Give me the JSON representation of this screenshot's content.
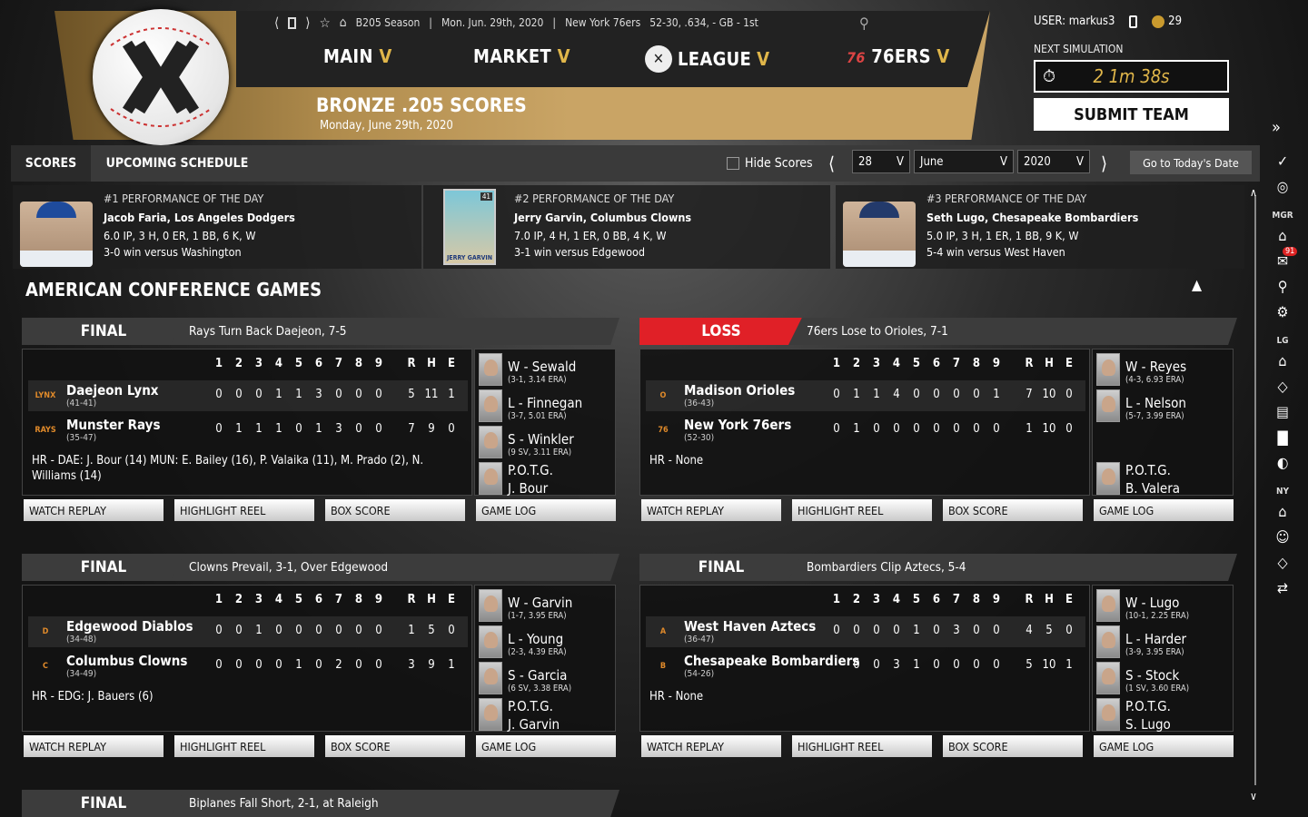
{
  "infobar": {
    "season": "B205 Season",
    "date_record": "Mon. Jun. 29th, 2020",
    "team": "New York 76ers",
    "record": "52-30, .634, - GB - 1st"
  },
  "nav": {
    "main": "MAIN",
    "market": "MARKET",
    "league": "LEAGUE",
    "team": "76ERS",
    "chev": "V"
  },
  "banner": {
    "title": "BRONZE .205 SCORES",
    "subtitle": "Monday, June 29th, 2020"
  },
  "user": {
    "label": "USER: markus3",
    "coins": "29"
  },
  "sim": {
    "label": "NEXT SIMULATION",
    "timer": "2 1m 38s",
    "submit": "SUBMIT TEAM"
  },
  "tabs": {
    "scores": "SCORES",
    "upcoming": "UPCOMING SCHEDULE",
    "hide_scores": "Hide Scores",
    "day": "28",
    "month": "June",
    "year": "2020",
    "today": "Go to Today's Date"
  },
  "perf": [
    {
      "title": "#1 PERFORMANCE OF THE DAY",
      "name": "Jacob Faria, Los Angeles Dodgers",
      "line": "6.0 IP, 3 H, 0 ER, 1 BB, 6 K, W",
      "result": "3-0 win versus Washington"
    },
    {
      "title": "#2 PERFORMANCE OF THE DAY",
      "name": "Jerry Garvin, Columbus Clowns",
      "line": "7.0 IP, 4 H, 1 ER, 0 BB, 4 K, W",
      "result": "3-1 win versus Edgewood",
      "card_text": "JERRY GARVIN",
      "card_num": "41"
    },
    {
      "title": "#3 PERFORMANCE OF THE DAY",
      "name": "Seth Lugo, Chesapeake Bombardiers",
      "line": "5.0 IP, 3 H, 1 ER, 1 BB, 9 K, W",
      "result": "5-4 win versus West Haven"
    }
  ],
  "section": "AMERICAN CONFERENCE GAMES",
  "innings": [
    "1",
    "2",
    "3",
    "4",
    "5",
    "6",
    "7",
    "8",
    "9",
    "R",
    "H",
    "E"
  ],
  "buttons": [
    "WATCH REPLAY",
    "HIGHLIGHT REEL",
    "BOX SCORE",
    "GAME LOG"
  ],
  "games": [
    {
      "status": "FINAL",
      "headline": "Rays Turn Back Daejeon, 7-5",
      "away": {
        "name": "Daejeon Lynx",
        "rec": "(41-41)",
        "line": [
          "0",
          "0",
          "0",
          "1",
          "1",
          "3",
          "0",
          "0",
          "0",
          "5",
          "11",
          "1"
        ],
        "logo": "LYNX"
      },
      "home": {
        "name": "Munster Rays",
        "rec": "(35-47)",
        "line": [
          "0",
          "1",
          "1",
          "1",
          "0",
          "1",
          "3",
          "0",
          "0",
          "7",
          "9",
          "0"
        ],
        "logo": "RAYS"
      },
      "hr": "HR - DAE: J. Bour (14)  MUN: E. Bailey (16), P. Valaika (11), M. Prado (2), N. Williams (14)",
      "w": "W - Sewald",
      "ws": "(3-1, 3.14 ERA)",
      "l": "L - Finnegan",
      "ls": "(3-7, 5.01 ERA)",
      "s": "S - Winkler",
      "ss": "(9 SV, 3.11 ERA)",
      "potg": "P.O.T.G.",
      "potg_name": "J. Bour"
    },
    {
      "status": "LOSS",
      "headline": "76ers Lose to Orioles, 7-1",
      "away": {
        "name": "Madison Orioles",
        "rec": "(36-43)",
        "line": [
          "0",
          "1",
          "1",
          "4",
          "0",
          "0",
          "0",
          "0",
          "1",
          "7",
          "10",
          "0"
        ],
        "logo": "O"
      },
      "home": {
        "name": "New York 76ers",
        "rec": "(52-30)",
        "line": [
          "0",
          "1",
          "0",
          "0",
          "0",
          "0",
          "0",
          "0",
          "0",
          "1",
          "10",
          "0"
        ],
        "logo": "76"
      },
      "hr": "HR - None",
      "w": "W - Reyes",
      "ws": "(4-3, 6.93 ERA)",
      "l": "L - Nelson",
      "ls": "(5-7, 3.99 ERA)",
      "s": "",
      "ss": "",
      "potg": "P.O.T.G.",
      "potg_name": "B. Valera"
    },
    {
      "status": "FINAL",
      "headline": "Clowns Prevail, 3-1, Over Edgewood",
      "away": {
        "name": "Edgewood Diablos",
        "rec": "(34-48)",
        "line": [
          "0",
          "0",
          "1",
          "0",
          "0",
          "0",
          "0",
          "0",
          "0",
          "1",
          "5",
          "0"
        ],
        "logo": "D"
      },
      "home": {
        "name": "Columbus Clowns",
        "rec": "(34-49)",
        "line": [
          "0",
          "0",
          "0",
          "0",
          "1",
          "0",
          "2",
          "0",
          "0",
          "3",
          "9",
          "1"
        ],
        "logo": "C"
      },
      "hr": "HR - EDG: J. Bauers (6)",
      "w": "W - Garvin",
      "ws": "(1-7, 3.95 ERA)",
      "l": "L - Young",
      "ls": "(2-3, 4.39 ERA)",
      "s": "S - Garcia",
      "ss": "(6 SV, 3.38 ERA)",
      "potg": "P.O.T.G.",
      "potg_name": "J. Garvin"
    },
    {
      "status": "FINAL",
      "headline": "Bombardiers Clip Aztecs, 5-4",
      "away": {
        "name": "West Haven Aztecs",
        "rec": "(36-47)",
        "line": [
          "0",
          "0",
          "0",
          "0",
          "1",
          "0",
          "3",
          "0",
          "0",
          "4",
          "5",
          "0"
        ],
        "logo": "A"
      },
      "home": {
        "name": "Chesapeake Bombardiers",
        "rec": "(54-26)",
        "line": [
          "",
          "0",
          "0",
          "3",
          "1",
          "0",
          "0",
          "0",
          "0",
          "5",
          "10",
          "1"
        ],
        "logo": "B"
      },
      "hr": "HR - None",
      "w": "W - Lugo",
      "ws": "(10-1, 2.25 ERA)",
      "l": "L - Harder",
      "ls": "(3-9, 3.95 ERA)",
      "s": "S - Stock",
      "ss": "(1 SV, 3.60 ERA)",
      "potg": "P.O.T.G.",
      "potg_name": "S. Lugo"
    }
  ],
  "next_game": {
    "status": "FINAL",
    "headline": "Biplanes Fall Short, 2-1, at Raleigh"
  },
  "rail": {
    "mgr": "MGR",
    "lg": "LG",
    "ny": "NY",
    "badge": "91"
  }
}
